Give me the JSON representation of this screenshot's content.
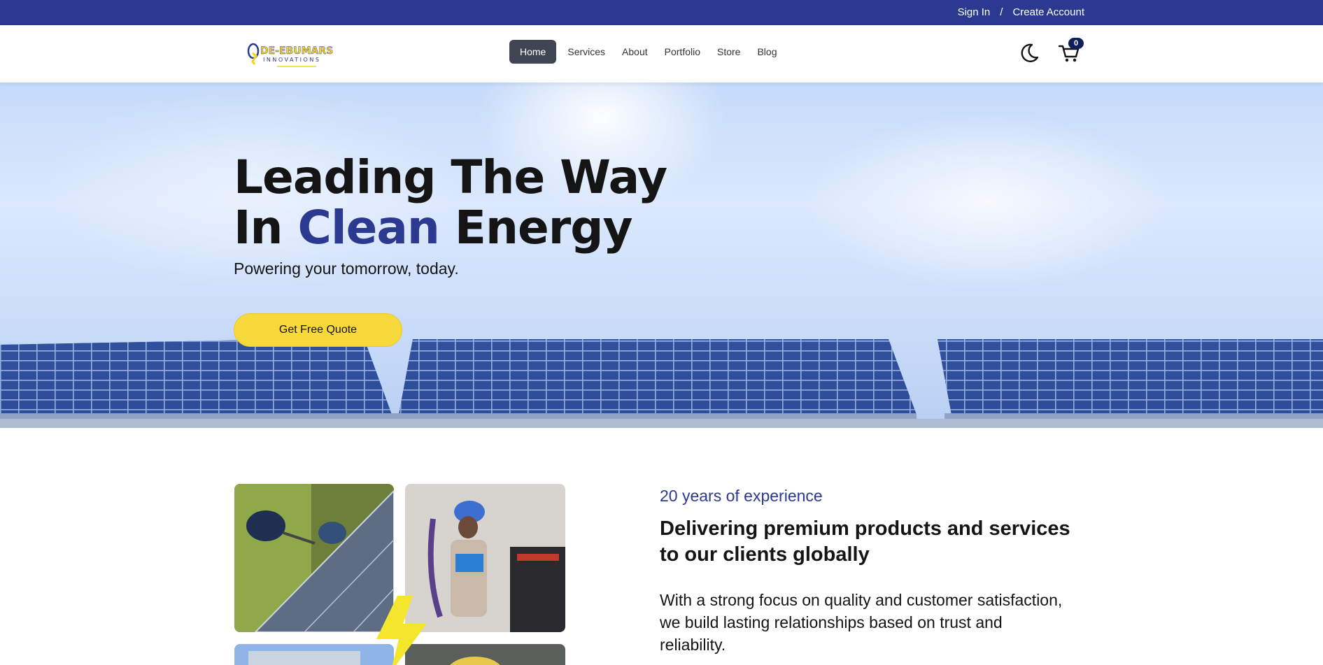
{
  "topbar": {
    "sign_in": "Sign In",
    "separator": "/",
    "create_account": "Create Account",
    "bg_color": "#2b3990"
  },
  "header": {
    "logo_text_main": "DE-EBUMARS",
    "logo_text_sub": "INNOVATIONS",
    "nav": [
      {
        "label": "Home",
        "active": true
      },
      {
        "label": "Services",
        "active": false
      },
      {
        "label": "About",
        "active": false
      },
      {
        "label": "Portfolio",
        "active": false
      },
      {
        "label": "Store",
        "active": false
      },
      {
        "label": "Blog",
        "active": false
      }
    ],
    "theme_toggle_icon": "moon-icon",
    "cart_icon": "cart-icon",
    "cart_count": "0"
  },
  "hero": {
    "title_line1": "Leading The Way",
    "title_line2_prefix": "In ",
    "title_line2_accent": "Clean",
    "title_line2_suffix": " Energy",
    "subtitle": "Powering your tomorrow, today.",
    "cta_label": "Get Free Quote",
    "accent_color": "#2b3990",
    "cta_color": "#f8d93b"
  },
  "about": {
    "experience": "20 years of experience",
    "title": "Delivering premium products and services to our clients globally",
    "text": "With a strong focus on quality and customer satisfaction, we build lasting relationships based on trust and reliability."
  }
}
